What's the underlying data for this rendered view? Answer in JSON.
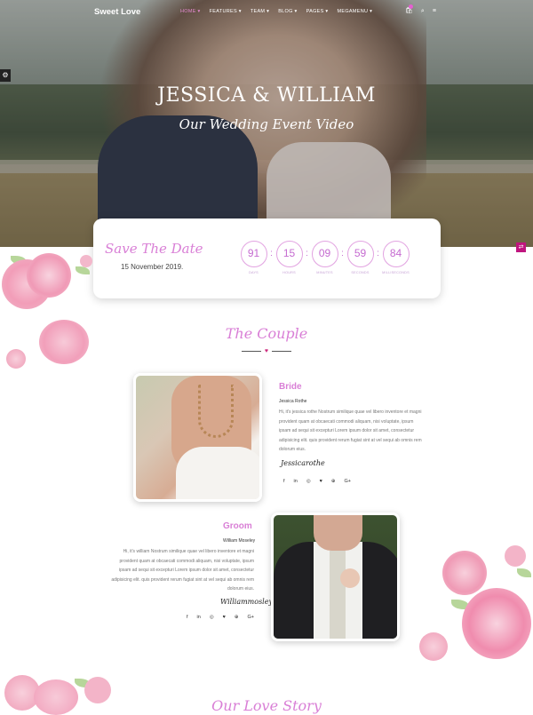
{
  "brand": {
    "name": "Sweet Love"
  },
  "nav": {
    "items": [
      "HOME ▾",
      "FEATURES ▾",
      "TEAM ▾",
      "BLOG ▾",
      "PAGES ▾",
      "MEGAMENU ▾"
    ],
    "active_index": 0,
    "icons": [
      "cart-icon",
      "search-icon",
      "menu-icon"
    ]
  },
  "hero": {
    "title": "JESSICA & WILLIAM",
    "subtitle": "Our Wedding Event Video"
  },
  "save_the_date": {
    "title": "Save The Date",
    "date": "15 November 2019.",
    "countdown": [
      {
        "value": "91",
        "label": "DAYS"
      },
      {
        "value": "15",
        "label": "HOURS"
      },
      {
        "value": "09",
        "label": "MINUTES"
      },
      {
        "value": "59",
        "label": "SECONDS"
      },
      {
        "value": "84",
        "label": "MILLISECONDS"
      }
    ]
  },
  "couple": {
    "title": "The Couple",
    "bride": {
      "role": "Bride",
      "name": "Jessica Rothe",
      "bio": "Hi, it's jessica rothe Nostrum similique quae vel libero inventore et magni provident quam at obcaecati commodi aliquam, nisi voluptate, ipsum ipsam ad sequi sit excepturi Lorem ipsum dolor sit amet, consectetur adipisicing elit. quis provident rerum fugiat sint at vel sequi ab omnis rem dolorum eius.",
      "signature": "Jessicarothe",
      "socials": [
        "f",
        "in",
        "◎",
        "♥",
        "⊕",
        "G+"
      ]
    },
    "groom": {
      "role": "Groom",
      "name": "William Moseley",
      "bio": "Hi, it's william Nostrum similique quae vel libero inventore et magni provident quam at obcaecati commodi aliquam, nisi voluptate, ipsum ipsam ad sequi sit excepturi Lorem ipsum dolor sit amet, consectetur adipisicing elit. quis provident rerum fugiat sint at vel sequi ab omnis rem dolorum eius.",
      "signature": "Williammosley",
      "socials": [
        "f",
        "in",
        "◎",
        "♥",
        "⊕",
        "G+"
      ]
    }
  },
  "love_story": {
    "title": "Our Love Story"
  },
  "colors": {
    "accent": "#d97fd6",
    "brand_pink": "#e45fd1",
    "heart": "#cc2a7c"
  }
}
